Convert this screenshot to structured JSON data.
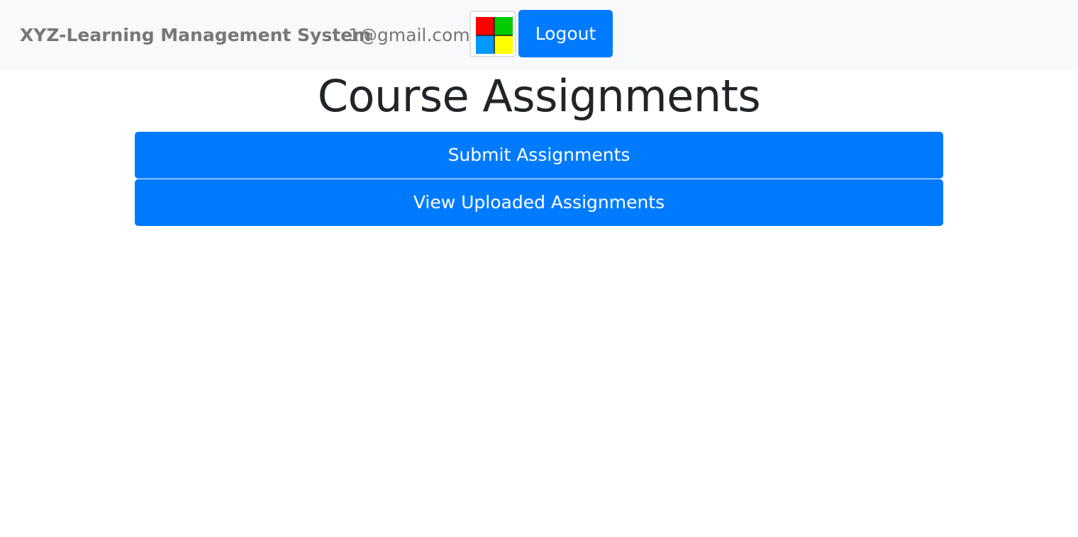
{
  "navbar": {
    "brand": "XYZ-Learning Management System",
    "user_email": "1@gmail.com",
    "avatar_icon": "four-color-grid-icon",
    "avatar_colors": [
      "#ff0000",
      "#00cc00",
      "#0099ff",
      "#ffff00"
    ],
    "logout_label": "Logout"
  },
  "main": {
    "title": "Course Assignments",
    "buttons": {
      "submit_label": "Submit Assignments",
      "view_label": "View Uploaded Assignments"
    }
  },
  "colors": {
    "primary": "#007bff",
    "navbar_bg": "#f8f9fa",
    "brand_text": "#777777",
    "title_text": "#212529"
  }
}
